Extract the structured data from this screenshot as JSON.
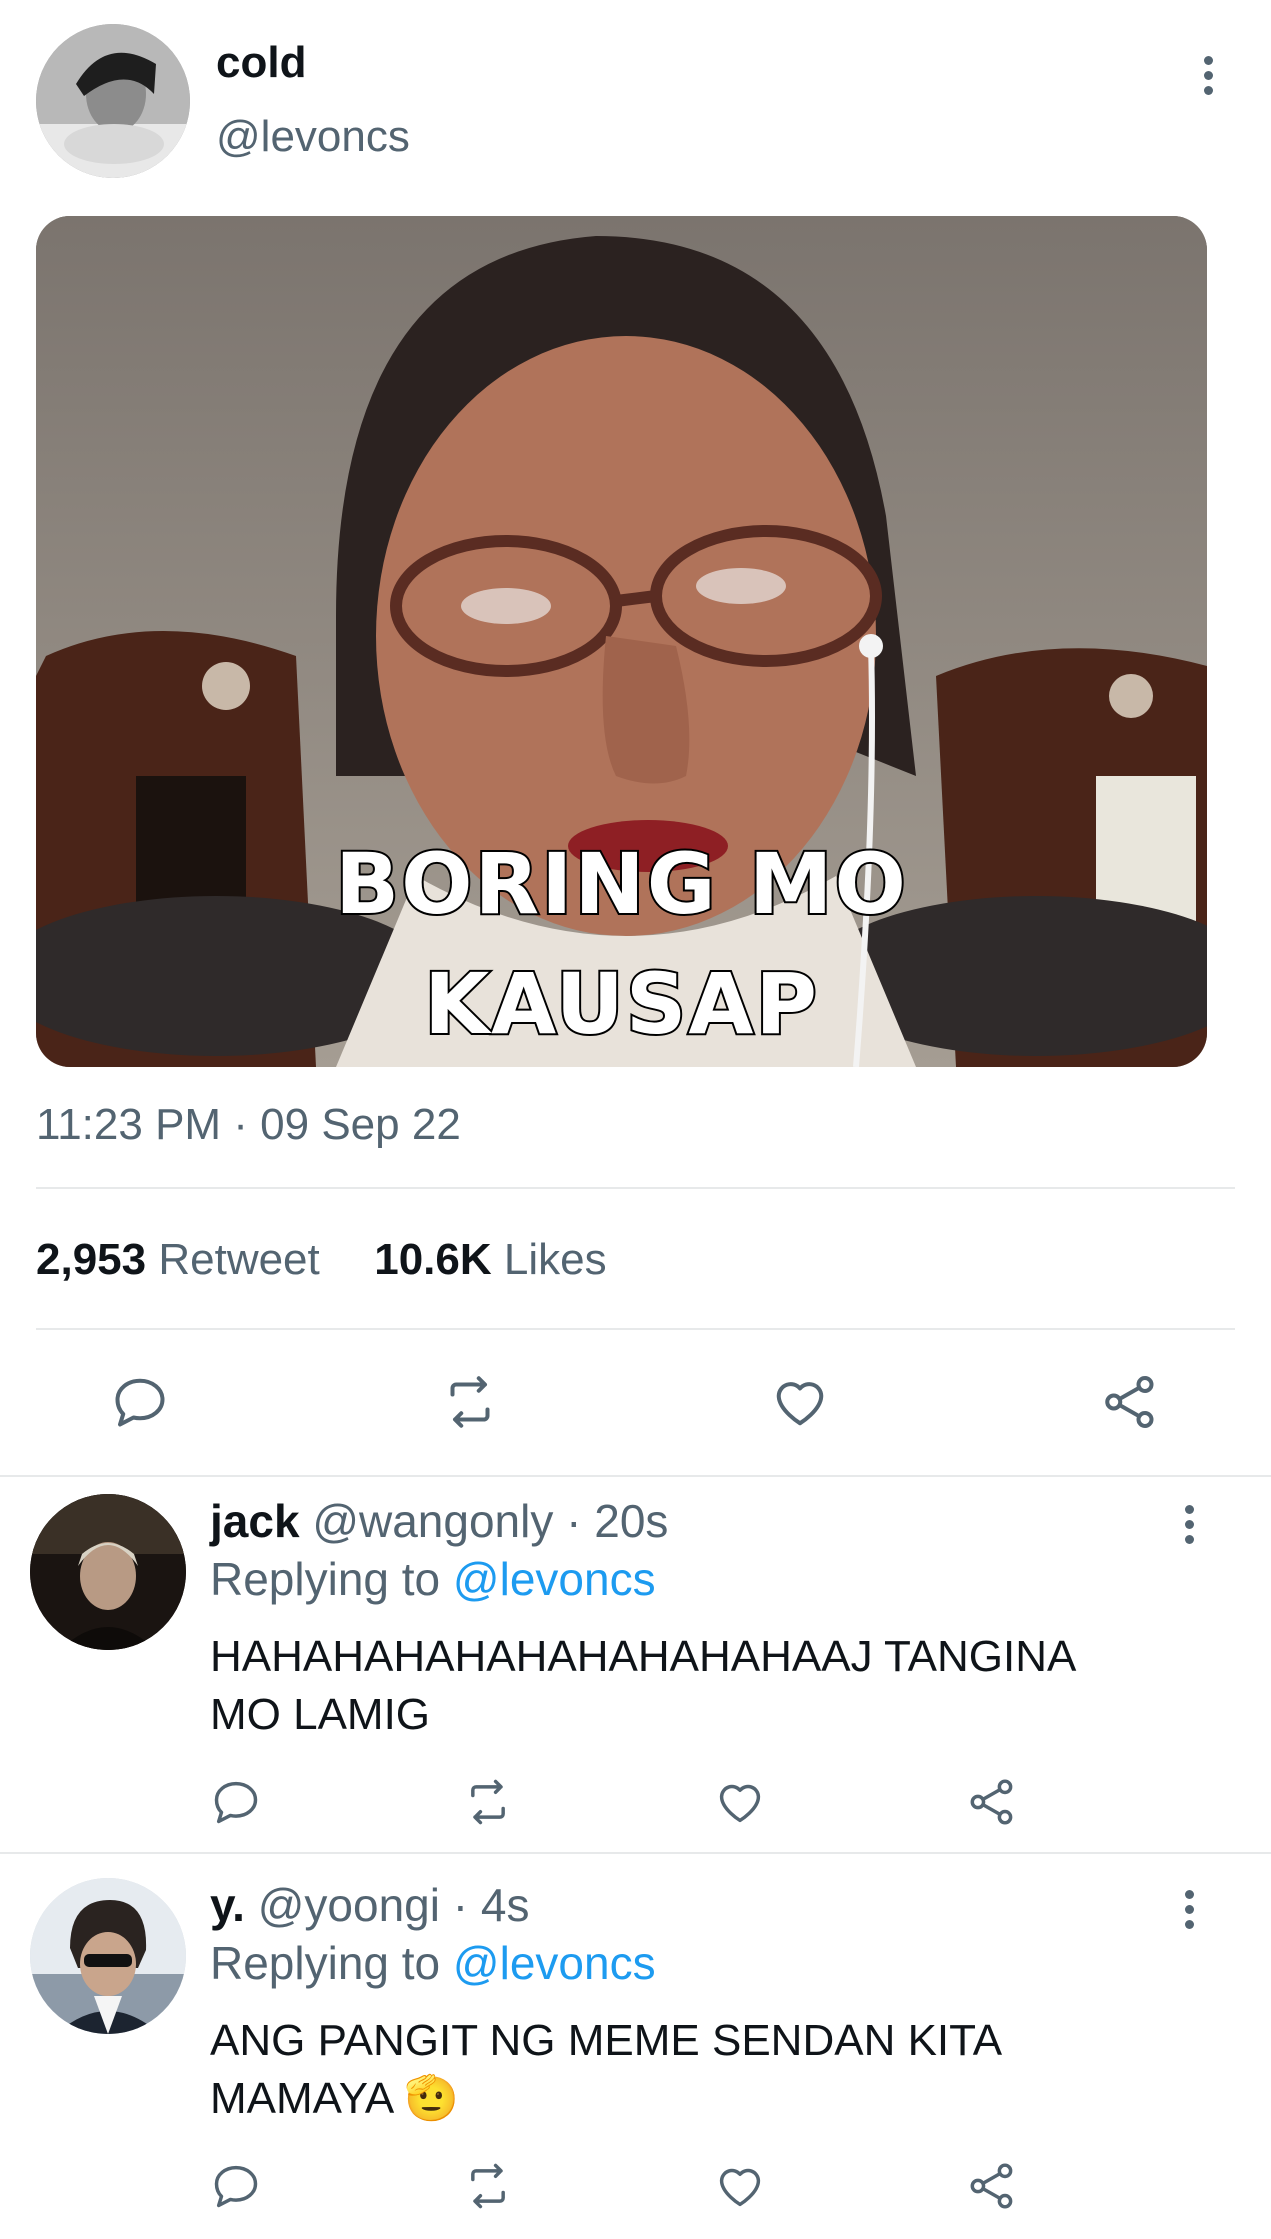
{
  "main_tweet": {
    "display_name": "cold",
    "handle": "@levoncs",
    "meme_caption_line1": "BORING MO",
    "meme_caption_line2": "KAUSAP",
    "timestamp": "11:23 PM · 09 Sep 22",
    "retweet_count": "2,953",
    "retweet_label": "Retweet",
    "like_count": "10.6K",
    "like_label": "Likes"
  },
  "replies": [
    {
      "display_name": "jack",
      "handle": "@wangonly",
      "time": "· 20s",
      "replying_prefix": "Replying to",
      "replying_handle": "@levoncs",
      "text_line1": "HAHAHAHAHAHAHAHAHAHAAJ TANGINA",
      "text_line2": "MO LAMIG"
    },
    {
      "display_name": "y.",
      "handle": "@yoongi",
      "time": "· 4s",
      "replying_prefix": "Replying to",
      "replying_handle": "@levoncs",
      "text_line1": "ANG PANGIT NG MEME SENDAN KITA",
      "text_line2": "MAMAYA",
      "emoji": "🫡"
    }
  ],
  "colors": {
    "text_primary": "#0f1419",
    "text_secondary": "#536471",
    "accent_link": "#1d9bf0",
    "divider": "#e7e9ea"
  },
  "icons": [
    "reply-icon",
    "retweet-icon",
    "like-icon",
    "share-icon",
    "more-options-icon"
  ]
}
